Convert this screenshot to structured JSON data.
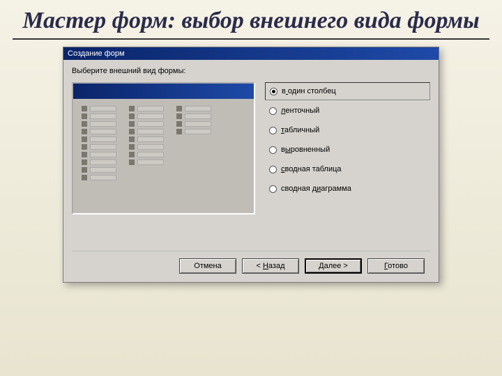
{
  "slide": {
    "title": "Мастер форм: выбор внешнего вида формы"
  },
  "dialog": {
    "titlebar": "Создание форм",
    "instruction": "Выберите внешний вид формы:",
    "options": [
      {
        "label": "в один столбец",
        "accel": 1,
        "checked": true
      },
      {
        "label": "ленточный",
        "accel": 0,
        "checked": false
      },
      {
        "label": "табличный",
        "accel": 0,
        "checked": false
      },
      {
        "label": "выровненный",
        "accel": 1,
        "checked": false
      },
      {
        "label": "сводная таблица",
        "accel": 0,
        "checked": false
      },
      {
        "label": "сводная диаграмма",
        "accel": 9,
        "checked": false
      }
    ],
    "buttons": {
      "cancel": "Отмена",
      "back": "< Назад",
      "next": "Далее >",
      "finish": "Готово"
    }
  }
}
